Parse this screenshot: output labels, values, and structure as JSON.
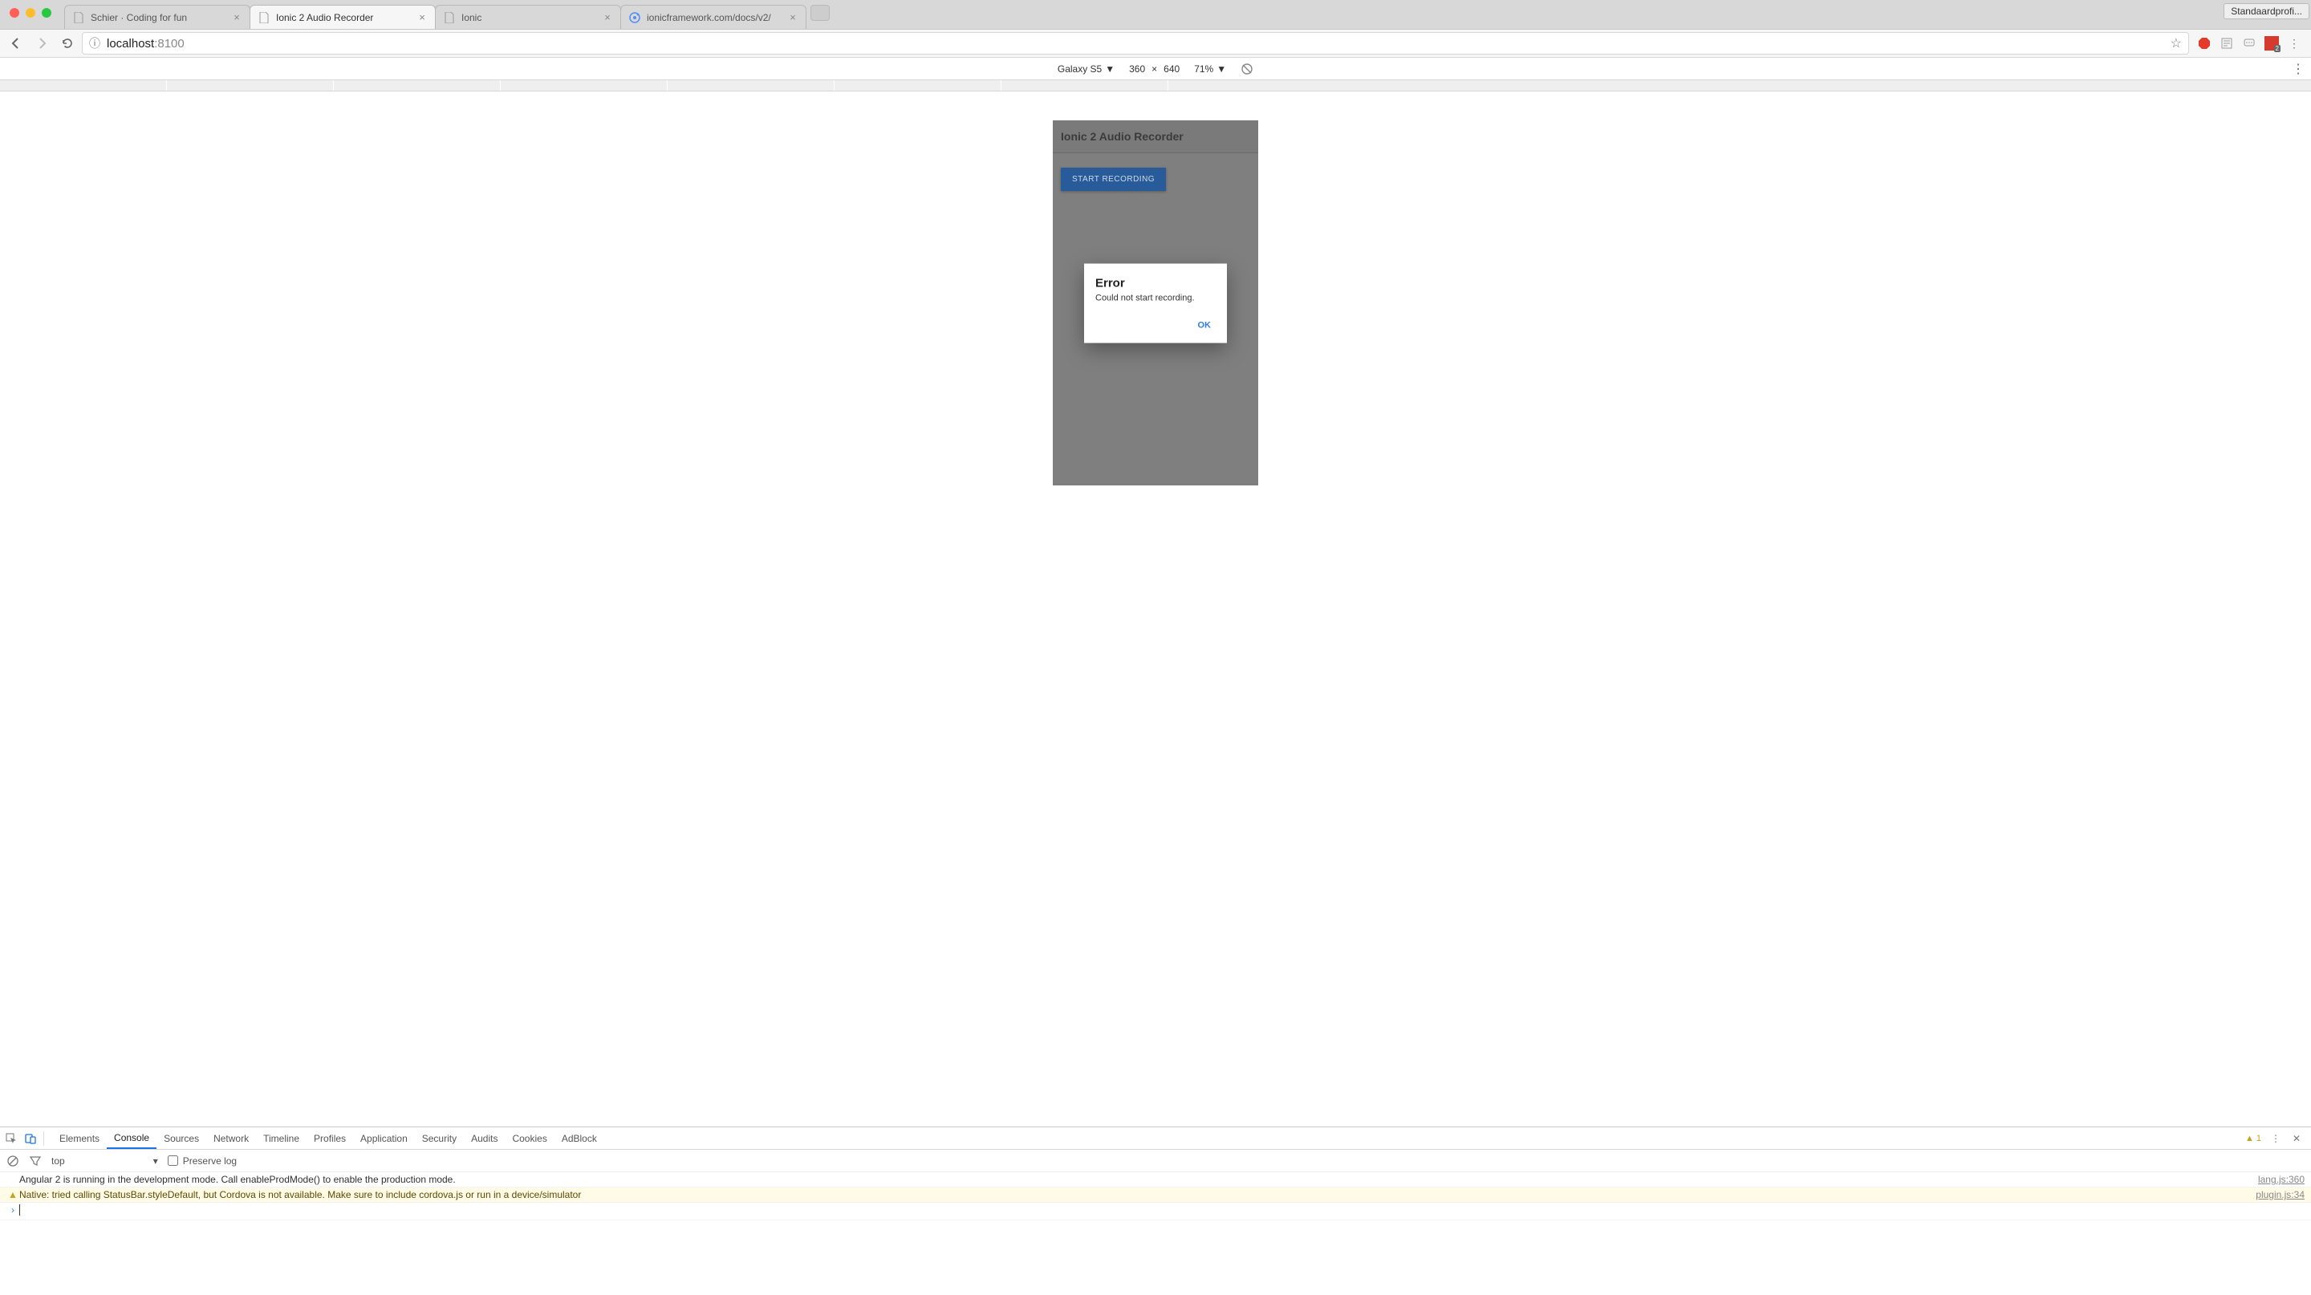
{
  "browser": {
    "profile_label": "Standaardprofi...",
    "tabs": [
      {
        "title": "Schier · Coding for fun",
        "active": false,
        "favicon": "page"
      },
      {
        "title": "Ionic 2 Audio Recorder",
        "active": true,
        "favicon": "page"
      },
      {
        "title": "Ionic",
        "active": false,
        "favicon": "page"
      },
      {
        "title": "ionicframework.com/docs/v2/",
        "active": false,
        "favicon": "ionic"
      }
    ],
    "url_host": "localhost",
    "url_port": ":8100"
  },
  "device_bar": {
    "device": "Galaxy S5",
    "width": "360",
    "separator": "×",
    "height": "640",
    "zoom": "71%"
  },
  "app": {
    "header_title": "Ionic 2 Audio Recorder",
    "start_button": "START RECORDING",
    "dialog": {
      "title": "Error",
      "message": "Could not start recording.",
      "ok": "OK"
    }
  },
  "devtools": {
    "tabs": [
      "Elements",
      "Console",
      "Sources",
      "Network",
      "Timeline",
      "Profiles",
      "Application",
      "Security",
      "Audits",
      "Cookies",
      "AdBlock"
    ],
    "active_tab": "Console",
    "warning_count": "1",
    "context": "top",
    "preserve_label": "Preserve log",
    "lines": [
      {
        "type": "log",
        "msg": "Angular 2 is running in the development mode. Call enableProdMode() to enable the production mode.",
        "src": "lang.js:360"
      },
      {
        "type": "warning",
        "msg": "Native: tried calling StatusBar.styleDefault, but Cordova is not available. Make sure to include cordova.js or run in a device/simulator",
        "src": "plugin.js:34"
      }
    ]
  }
}
